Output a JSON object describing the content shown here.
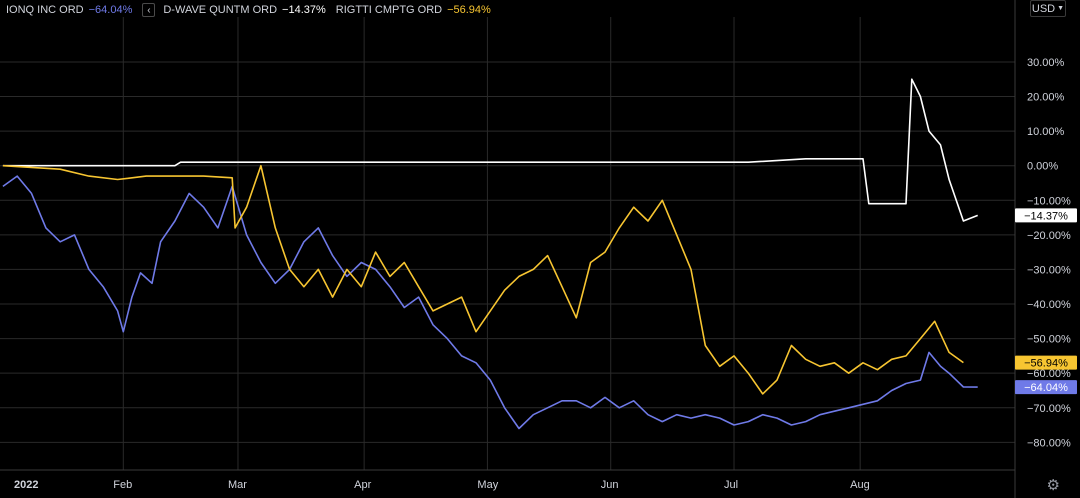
{
  "legend": [
    {
      "name": "IONQ INC ORD",
      "value": "−64.04%",
      "color": "#6f7ae8"
    },
    {
      "name": "D-WAVE QUNTM ORD",
      "value": "−14.37%",
      "color": "#ffffff"
    },
    {
      "name": "RIGTTI CMPTG ORD",
      "value": "−56.94%",
      "color": "#f7c531"
    }
  ],
  "collapse_icon": "chevron-left-icon",
  "currency": {
    "label": "USD",
    "icon": "chevron-down-icon"
  },
  "settings_icon": "gear-icon",
  "colors": {
    "background": "#000000",
    "grid": "#2a2a2a",
    "text": "#d1d4dc"
  },
  "chart_data": {
    "type": "line",
    "x_unit": "week index from first trading week of 2022",
    "x_ticks": [
      {
        "label": "2022",
        "x": 0,
        "bold": true
      },
      {
        "label": "Feb",
        "x": 4.2
      },
      {
        "label": "Mar",
        "x": 8.2
      },
      {
        "label": "Apr",
        "x": 12.6
      },
      {
        "label": "May",
        "x": 16.9
      },
      {
        "label": "Jun",
        "x": 21.2
      },
      {
        "label": "Jul",
        "x": 25.5
      },
      {
        "label": "Aug",
        "x": 29.9
      }
    ],
    "y_ticks": [
      "30.00%",
      "20.00%",
      "10.00%",
      "0.00%",
      "−10.00%",
      "−20.00%",
      "−30.00%",
      "−40.00%",
      "−50.00%",
      "−60.00%",
      "−70.00%",
      "−80.00%"
    ],
    "y_tick_values": [
      30,
      20,
      10,
      0,
      -10,
      -20,
      -30,
      -40,
      -50,
      -60,
      -70,
      -80
    ],
    "ylim": [
      -88,
      43
    ],
    "xlim": [
      -0.1,
      35.3
    ],
    "grid": true,
    "series": [
      {
        "name": "IONQ INC ORD",
        "color": "#6f7ae8",
        "last_label": "−64.04%",
        "last": -64.04,
        "points": [
          [
            0,
            -6
          ],
          [
            0.5,
            -3
          ],
          [
            1,
            -8
          ],
          [
            1.5,
            -18
          ],
          [
            2,
            -22
          ],
          [
            2.5,
            -20
          ],
          [
            3,
            -30
          ],
          [
            3.5,
            -35
          ],
          [
            4,
            -42
          ],
          [
            4.2,
            -48
          ],
          [
            4.5,
            -38
          ],
          [
            4.8,
            -31
          ],
          [
            5.2,
            -34
          ],
          [
            5.5,
            -22
          ],
          [
            6,
            -16
          ],
          [
            6.5,
            -8
          ],
          [
            7,
            -12
          ],
          [
            7.5,
            -18
          ],
          [
            8,
            -6
          ],
          [
            8.5,
            -20
          ],
          [
            9,
            -28
          ],
          [
            9.5,
            -34
          ],
          [
            10,
            -30
          ],
          [
            10.5,
            -22
          ],
          [
            11,
            -18
          ],
          [
            11.5,
            -26
          ],
          [
            12,
            -32
          ],
          [
            12.5,
            -28
          ],
          [
            13,
            -30
          ],
          [
            13.5,
            -35
          ],
          [
            14,
            -41
          ],
          [
            14.5,
            -38
          ],
          [
            15,
            -46
          ],
          [
            15.5,
            -50
          ],
          [
            16,
            -55
          ],
          [
            16.5,
            -57
          ],
          [
            17,
            -62
          ],
          [
            17.5,
            -70
          ],
          [
            18,
            -76
          ],
          [
            18.5,
            -72
          ],
          [
            19,
            -70
          ],
          [
            19.5,
            -68
          ],
          [
            20,
            -68
          ],
          [
            20.5,
            -70
          ],
          [
            21,
            -67
          ],
          [
            21.5,
            -70
          ],
          [
            22,
            -68
          ],
          [
            22.5,
            -72
          ],
          [
            23,
            -74
          ],
          [
            23.5,
            -72
          ],
          [
            24,
            -73
          ],
          [
            24.5,
            -72
          ],
          [
            25,
            -73
          ],
          [
            25.5,
            -75
          ],
          [
            26,
            -74
          ],
          [
            26.5,
            -72
          ],
          [
            27,
            -73
          ],
          [
            27.5,
            -75
          ],
          [
            28,
            -74
          ],
          [
            28.5,
            -72
          ],
          [
            29,
            -71
          ],
          [
            29.5,
            -70
          ],
          [
            30,
            -69
          ],
          [
            30.5,
            -68
          ],
          [
            31,
            -65
          ],
          [
            31.5,
            -63
          ],
          [
            32,
            -62
          ],
          [
            32.3,
            -54
          ],
          [
            32.7,
            -58
          ],
          [
            33,
            -60
          ],
          [
            33.5,
            -64
          ],
          [
            34,
            -64.04
          ]
        ]
      },
      {
        "name": "D-WAVE QUNTM ORD",
        "color": "#ffffff",
        "last_label": "−14.37%",
        "last": -14.37,
        "points": [
          [
            0,
            0
          ],
          [
            4,
            0
          ],
          [
            6,
            0
          ],
          [
            6.2,
            1
          ],
          [
            8,
            1
          ],
          [
            10,
            1
          ],
          [
            12,
            1
          ],
          [
            14,
            1
          ],
          [
            16,
            1
          ],
          [
            20,
            1
          ],
          [
            24,
            1
          ],
          [
            26,
            1
          ],
          [
            28,
            2
          ],
          [
            30,
            2
          ],
          [
            30.2,
            -11
          ],
          [
            31.5,
            -11
          ],
          [
            31.7,
            25
          ],
          [
            32,
            20
          ],
          [
            32.3,
            10
          ],
          [
            32.7,
            6
          ],
          [
            33,
            -4
          ],
          [
            33.5,
            -16
          ],
          [
            34,
            -14.37
          ]
        ]
      },
      {
        "name": "RIGTTI CMPTG ORD",
        "color": "#f7c531",
        "last_label": "−56.94%",
        "last": -56.94,
        "points": [
          [
            0,
            0
          ],
          [
            2,
            -1
          ],
          [
            3,
            -3
          ],
          [
            4,
            -4
          ],
          [
            5,
            -3
          ],
          [
            6,
            -3
          ],
          [
            7,
            -3
          ],
          [
            8,
            -3.5
          ],
          [
            8.1,
            -18
          ],
          [
            8.5,
            -12
          ],
          [
            9,
            0
          ],
          [
            9.5,
            -18
          ],
          [
            10,
            -30
          ],
          [
            10.5,
            -35
          ],
          [
            11,
            -30
          ],
          [
            11.5,
            -38
          ],
          [
            12,
            -30
          ],
          [
            12.5,
            -35
          ],
          [
            13,
            -25
          ],
          [
            13.5,
            -32
          ],
          [
            14,
            -28
          ],
          [
            14.5,
            -35
          ],
          [
            15,
            -42
          ],
          [
            15.5,
            -40
          ],
          [
            16,
            -38
          ],
          [
            16.5,
            -48
          ],
          [
            17,
            -42
          ],
          [
            17.5,
            -36
          ],
          [
            18,
            -32
          ],
          [
            18.5,
            -30
          ],
          [
            19,
            -26
          ],
          [
            19.5,
            -35
          ],
          [
            20,
            -44
          ],
          [
            20.5,
            -28
          ],
          [
            21,
            -25
          ],
          [
            21.5,
            -18
          ],
          [
            22,
            -12
          ],
          [
            22.5,
            -16
          ],
          [
            23,
            -10
          ],
          [
            23.5,
            -20
          ],
          [
            24,
            -30
          ],
          [
            24.5,
            -52
          ],
          [
            25,
            -58
          ],
          [
            25.5,
            -55
          ],
          [
            26,
            -60
          ],
          [
            26.5,
            -66
          ],
          [
            27,
            -62
          ],
          [
            27.5,
            -52
          ],
          [
            28,
            -56
          ],
          [
            28.5,
            -58
          ],
          [
            29,
            -57
          ],
          [
            29.5,
            -60
          ],
          [
            30,
            -57
          ],
          [
            30.5,
            -59
          ],
          [
            31,
            -56
          ],
          [
            31.5,
            -55
          ],
          [
            32,
            -50
          ],
          [
            32.5,
            -45
          ],
          [
            33,
            -54
          ],
          [
            33.5,
            -56.94
          ]
        ]
      }
    ]
  }
}
